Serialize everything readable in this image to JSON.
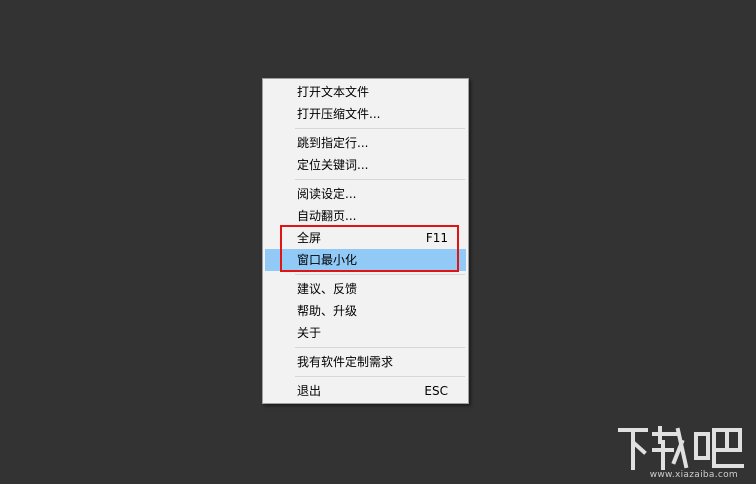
{
  "menu": {
    "groups": [
      {
        "items": [
          {
            "label": "打开文本文件",
            "shortcut": ""
          },
          {
            "label": "打开压缩文件...",
            "shortcut": ""
          }
        ]
      },
      {
        "items": [
          {
            "label": "跳到指定行...",
            "shortcut": ""
          },
          {
            "label": "定位关键词...",
            "shortcut": ""
          }
        ]
      },
      {
        "items": [
          {
            "label": "阅读设定...",
            "shortcut": ""
          },
          {
            "label": "自动翻页...",
            "shortcut": ""
          },
          {
            "label": "全屏",
            "shortcut": "F11"
          },
          {
            "label": "窗口最小化",
            "shortcut": "",
            "highlighted": true
          }
        ]
      },
      {
        "items": [
          {
            "label": "建议、反馈",
            "shortcut": ""
          },
          {
            "label": "帮助、升级",
            "shortcut": ""
          },
          {
            "label": "关于",
            "shortcut": ""
          }
        ]
      },
      {
        "items": [
          {
            "label": "我有软件定制需求",
            "shortcut": ""
          }
        ]
      },
      {
        "items": [
          {
            "label": "退出",
            "shortcut": "ESC"
          }
        ]
      }
    ]
  },
  "colors": {
    "background": "#333333",
    "menu_bg": "#f2f2f2",
    "highlight": "#91c9f7",
    "annotation_box": "#e11414"
  },
  "watermark": {
    "logo": "下载吧",
    "url": "www.xiazaiba.com"
  }
}
